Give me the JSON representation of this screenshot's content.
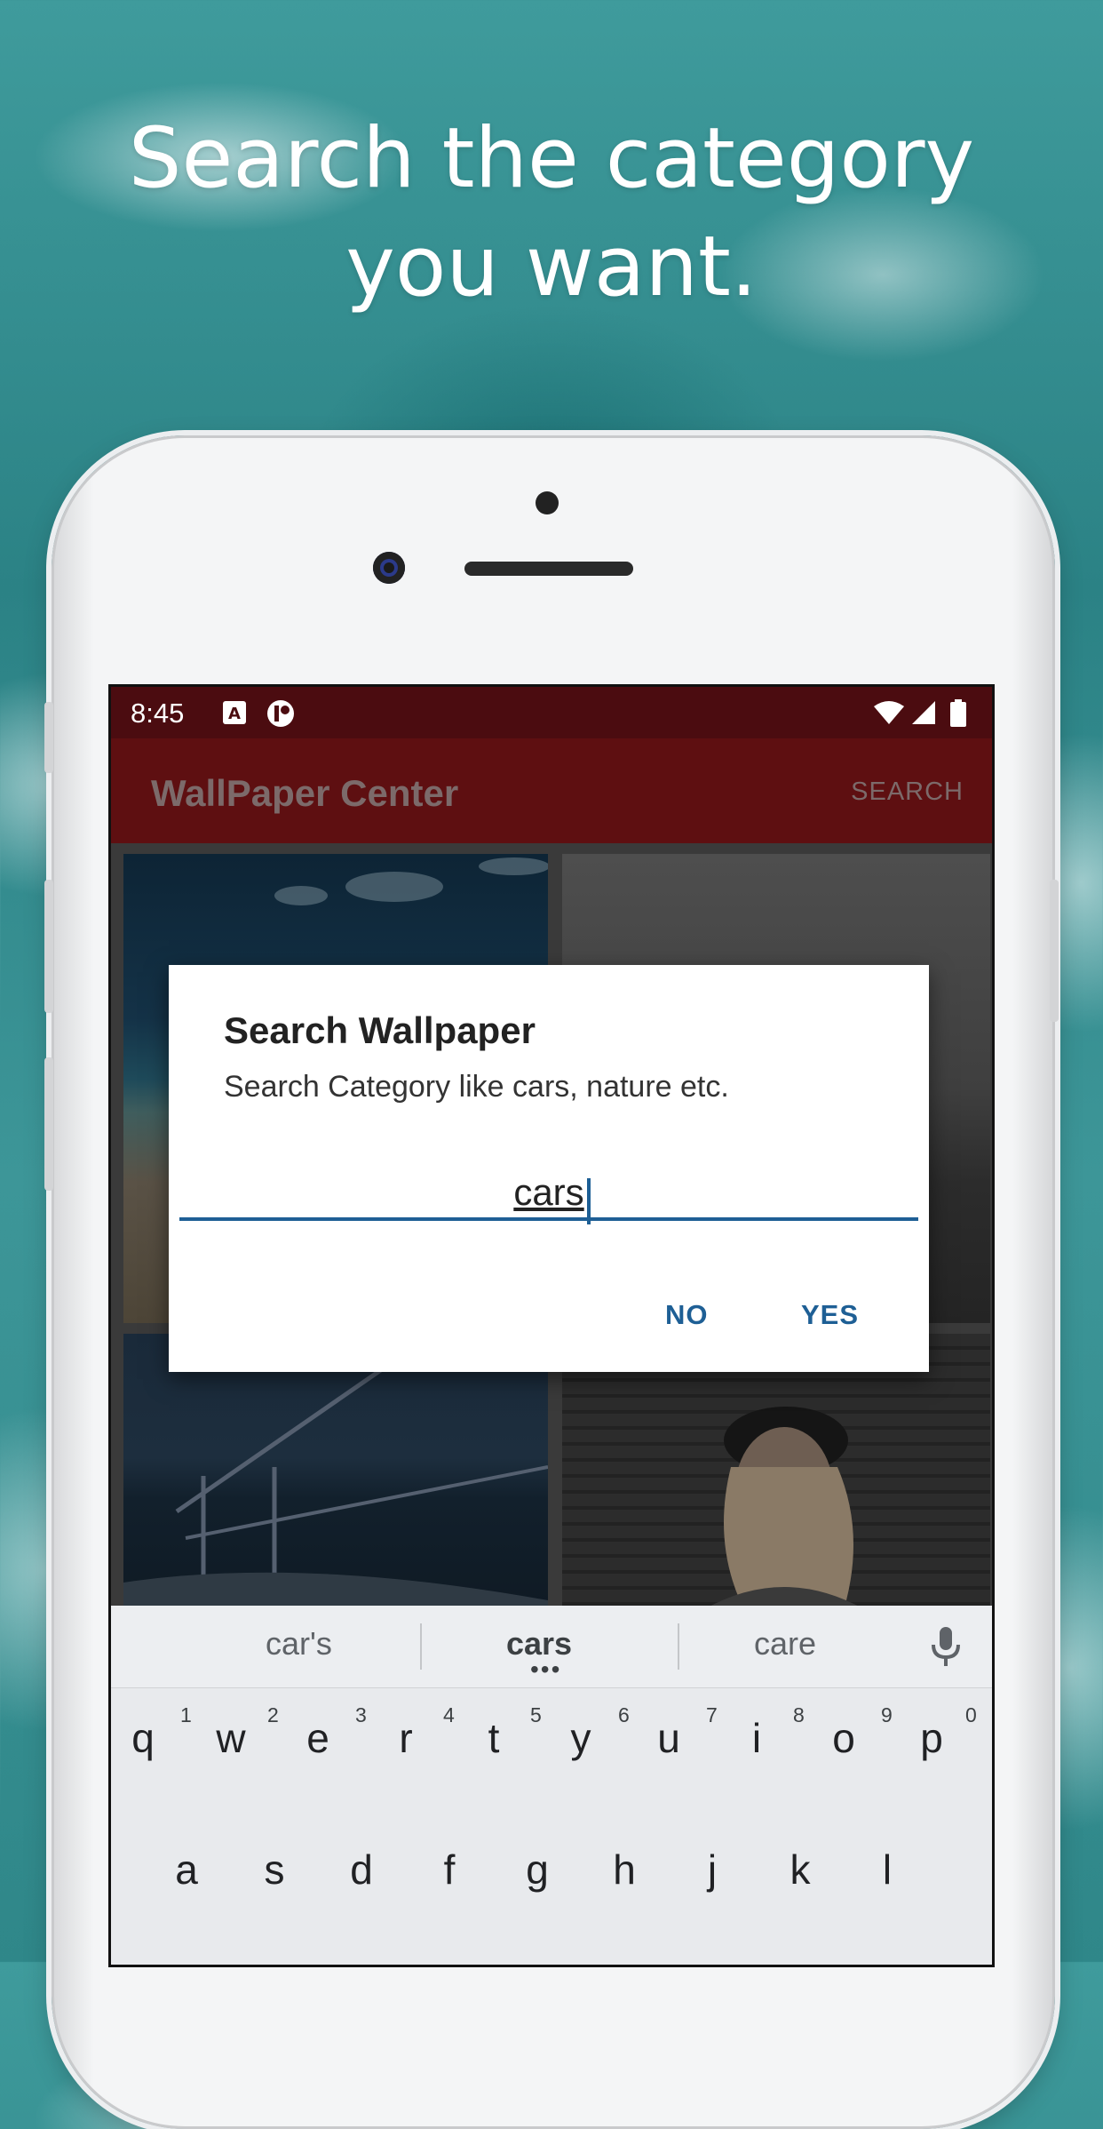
{
  "headline": "Search the category you want.",
  "status_bar": {
    "time": "8:45"
  },
  "app": {
    "title": "WallPaper Center",
    "action": "SEARCH"
  },
  "dialog": {
    "title": "Search Wallpaper",
    "message": "Search Category like cars, nature etc.",
    "input_value": "cars",
    "no_label": "NO",
    "yes_label": "YES"
  },
  "keyboard": {
    "suggestions": [
      "car's",
      "cars",
      "care"
    ],
    "row1": [
      "q",
      "w",
      "e",
      "r",
      "t",
      "y",
      "u",
      "i",
      "o",
      "p"
    ],
    "row1_hints": [
      "1",
      "2",
      "3",
      "4",
      "5",
      "6",
      "7",
      "8",
      "9",
      "0"
    ],
    "row2": [
      "a",
      "s",
      "d",
      "f",
      "g",
      "h",
      "j",
      "k",
      "l"
    ]
  },
  "colors": {
    "status_bar": "#4b0c10",
    "app_bar": "#5e0f11",
    "accent": "#1e5f95"
  }
}
